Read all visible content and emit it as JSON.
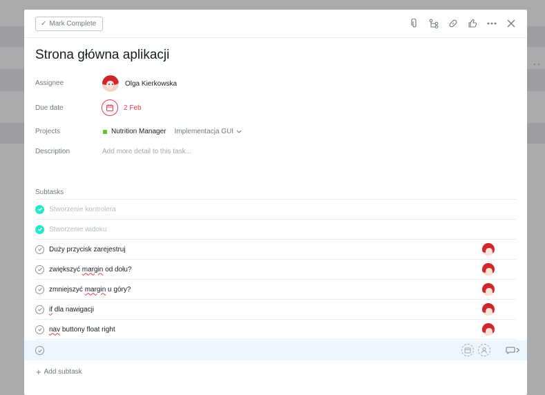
{
  "header": {
    "mark_complete_label": "Mark Complete",
    "icons": [
      "attachment-icon",
      "subtasks-icon",
      "link-icon",
      "like-icon",
      "more-icon",
      "close-icon"
    ]
  },
  "task": {
    "title": "Strona główna aplikacji",
    "assignee_label": "Assignee",
    "assignee_name": "Olga Kierkowska",
    "due_label": "Due date",
    "due_date": "2 Feb",
    "projects_label": "Projects",
    "project_name": "Nutrition Manager",
    "project_section": "Implementacja GUI",
    "description_label": "Description",
    "description_placeholder": "Add more detail to this task..."
  },
  "subtasks": {
    "label": "Subtasks",
    "items": [
      {
        "name": "Stworzenie kontrolera",
        "completed": true,
        "assigned": false
      },
      {
        "name": "Stworzenie widoku",
        "completed": true,
        "assigned": false
      },
      {
        "name": "Duży przycisk zarejestruj",
        "completed": false,
        "assigned": true
      },
      {
        "name_parts": [
          "zwiększyć ",
          "margin",
          " od dołu?"
        ],
        "completed": false,
        "assigned": true
      },
      {
        "name_parts": [
          "zmniejszyć ",
          "margin",
          " u góry?"
        ],
        "completed": false,
        "assigned": true
      },
      {
        "name_parts": [
          "",
          "if",
          " dla nawigacji"
        ],
        "completed": false,
        "assigned": true
      },
      {
        "name_parts": [
          "",
          "nav",
          " buttony float right"
        ],
        "completed": false,
        "assigned": true
      }
    ],
    "add_label": "Add subtask"
  },
  "colors": {
    "accent_red": "#e8384f",
    "complete_teal": "#25e8c8",
    "project_green": "#62c430",
    "new_row_bg": "#edf6fd"
  }
}
